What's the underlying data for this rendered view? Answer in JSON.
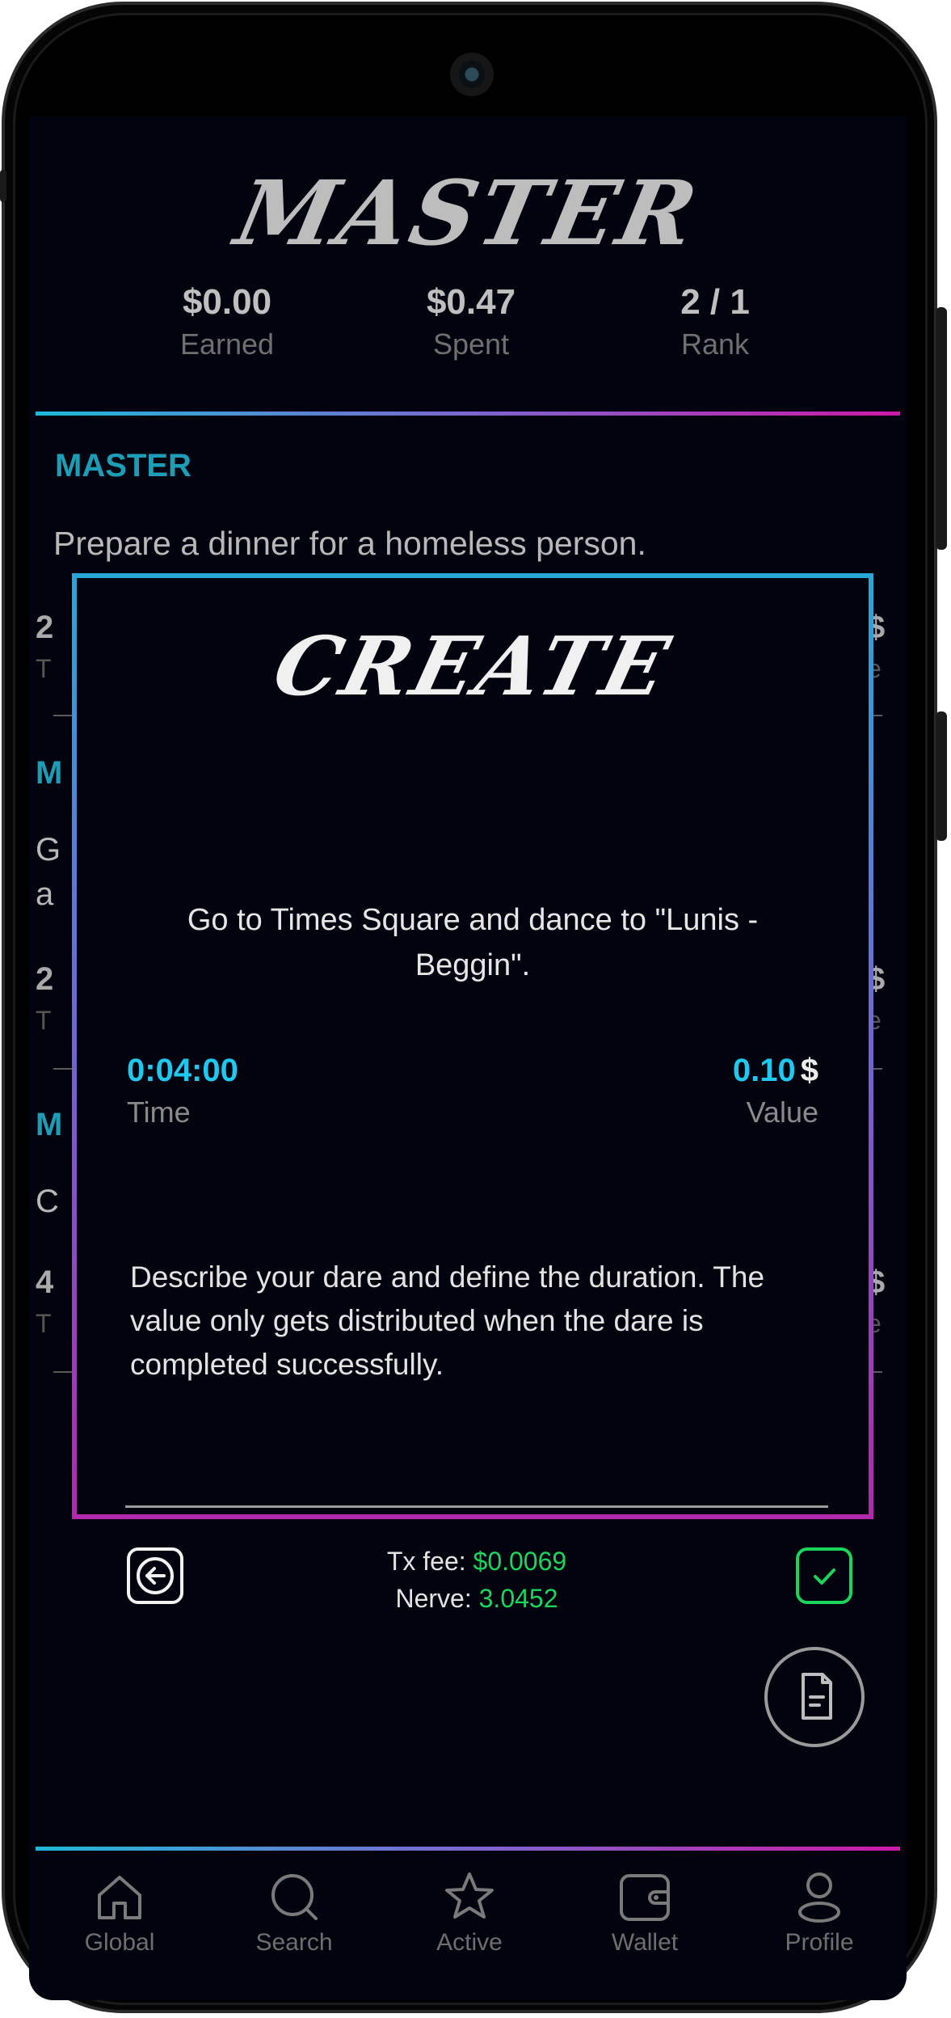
{
  "header": {
    "logo_text": "MASTER",
    "stats": [
      {
        "value": "$0.00",
        "label": "Earned"
      },
      {
        "value": "$0.47",
        "label": "Spent"
      },
      {
        "value": "2 / 1",
        "label": "Rank"
      }
    ]
  },
  "background_list": {
    "first_item": {
      "title": "MASTER",
      "description": "Prepare a dinner for a homeless person."
    },
    "partial_fragments": {
      "row1_num": "2",
      "row1_sub": "T",
      "row1_dollar": "$",
      "row1_e": "e",
      "item2_title": "M",
      "item2_line1": "G",
      "item2_line2": "a",
      "row2_num": "2",
      "row2_sub": "T",
      "row2_dollar": "$",
      "row2_e": "e",
      "item3_title": "M",
      "item3_line1": "C",
      "row3_num": "4",
      "row3_sub": "T",
      "row3_dollar": "$",
      "row3_e": "e"
    }
  },
  "modal": {
    "title": "CREATE",
    "dare_text": "Go to Times Square and dance to \"Lunis - Beggin\".",
    "time_value": "0:04:00",
    "time_label": "Time",
    "value_amount": "0.10",
    "value_currency": "$",
    "value_label": "Value",
    "info_text": "Describe your dare and define the duration. The value only gets distributed when the dare is completed successfully.",
    "tx_fee_label": "Tx fee:",
    "tx_fee_value": "$0.0069",
    "nerve_label": "Nerve:",
    "nerve_value": "3.0452",
    "back_icon": "arrow-left-icon",
    "confirm_icon": "check-icon"
  },
  "fabs": [
    {
      "icon": "circle-button-icon"
    },
    {
      "icon": "document-icon"
    }
  ],
  "bottom_nav": [
    {
      "label": "Global",
      "icon": "home-icon"
    },
    {
      "label": "Search",
      "icon": "search-icon"
    },
    {
      "label": "Active",
      "icon": "star-icon"
    },
    {
      "label": "Wallet",
      "icon": "wallet-icon"
    },
    {
      "label": "Profile",
      "icon": "user-icon"
    }
  ],
  "colors": {
    "accent_cyan": "#1ec8ee",
    "accent_teal": "#1d9eb6",
    "accent_magenta": "#cc1aa8",
    "success_green": "#1ad65c",
    "background": "#02030f"
  }
}
